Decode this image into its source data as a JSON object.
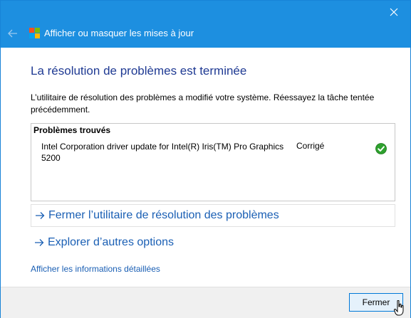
{
  "window": {
    "title": "Afficher ou masquer les mises à jour",
    "close_icon": "close-icon",
    "back_icon": "back-arrow-icon",
    "app_icon": "windows-update-icon",
    "titlebar_color": "#1d8fe0"
  },
  "main": {
    "heading": "La résolution de problèmes est terminée",
    "description": "L’utilitaire de résolution des problèmes a modifié votre système. Réessayez la tâche tentée précédemment.",
    "problems": {
      "header": "Problèmes trouvés",
      "items": [
        {
          "name": "Intel Corporation driver update for Intel(R) Iris(TM) Pro Graphics 5200",
          "status": "Corrigé",
          "status_icon": "green-check-icon"
        }
      ]
    },
    "links": [
      {
        "label": "Fermer l’utilitaire de résolution des problèmes",
        "icon": "arrow-right-icon"
      },
      {
        "label": "Explorer d’autres options",
        "icon": "arrow-right-icon"
      }
    ],
    "details_link": "Afficher les informations détaillées"
  },
  "footer": {
    "close_button_label": "Fermer"
  },
  "colors": {
    "heading": "#1f3a93",
    "link": "#1a5fb4",
    "status_ok": "#2ea12e"
  }
}
